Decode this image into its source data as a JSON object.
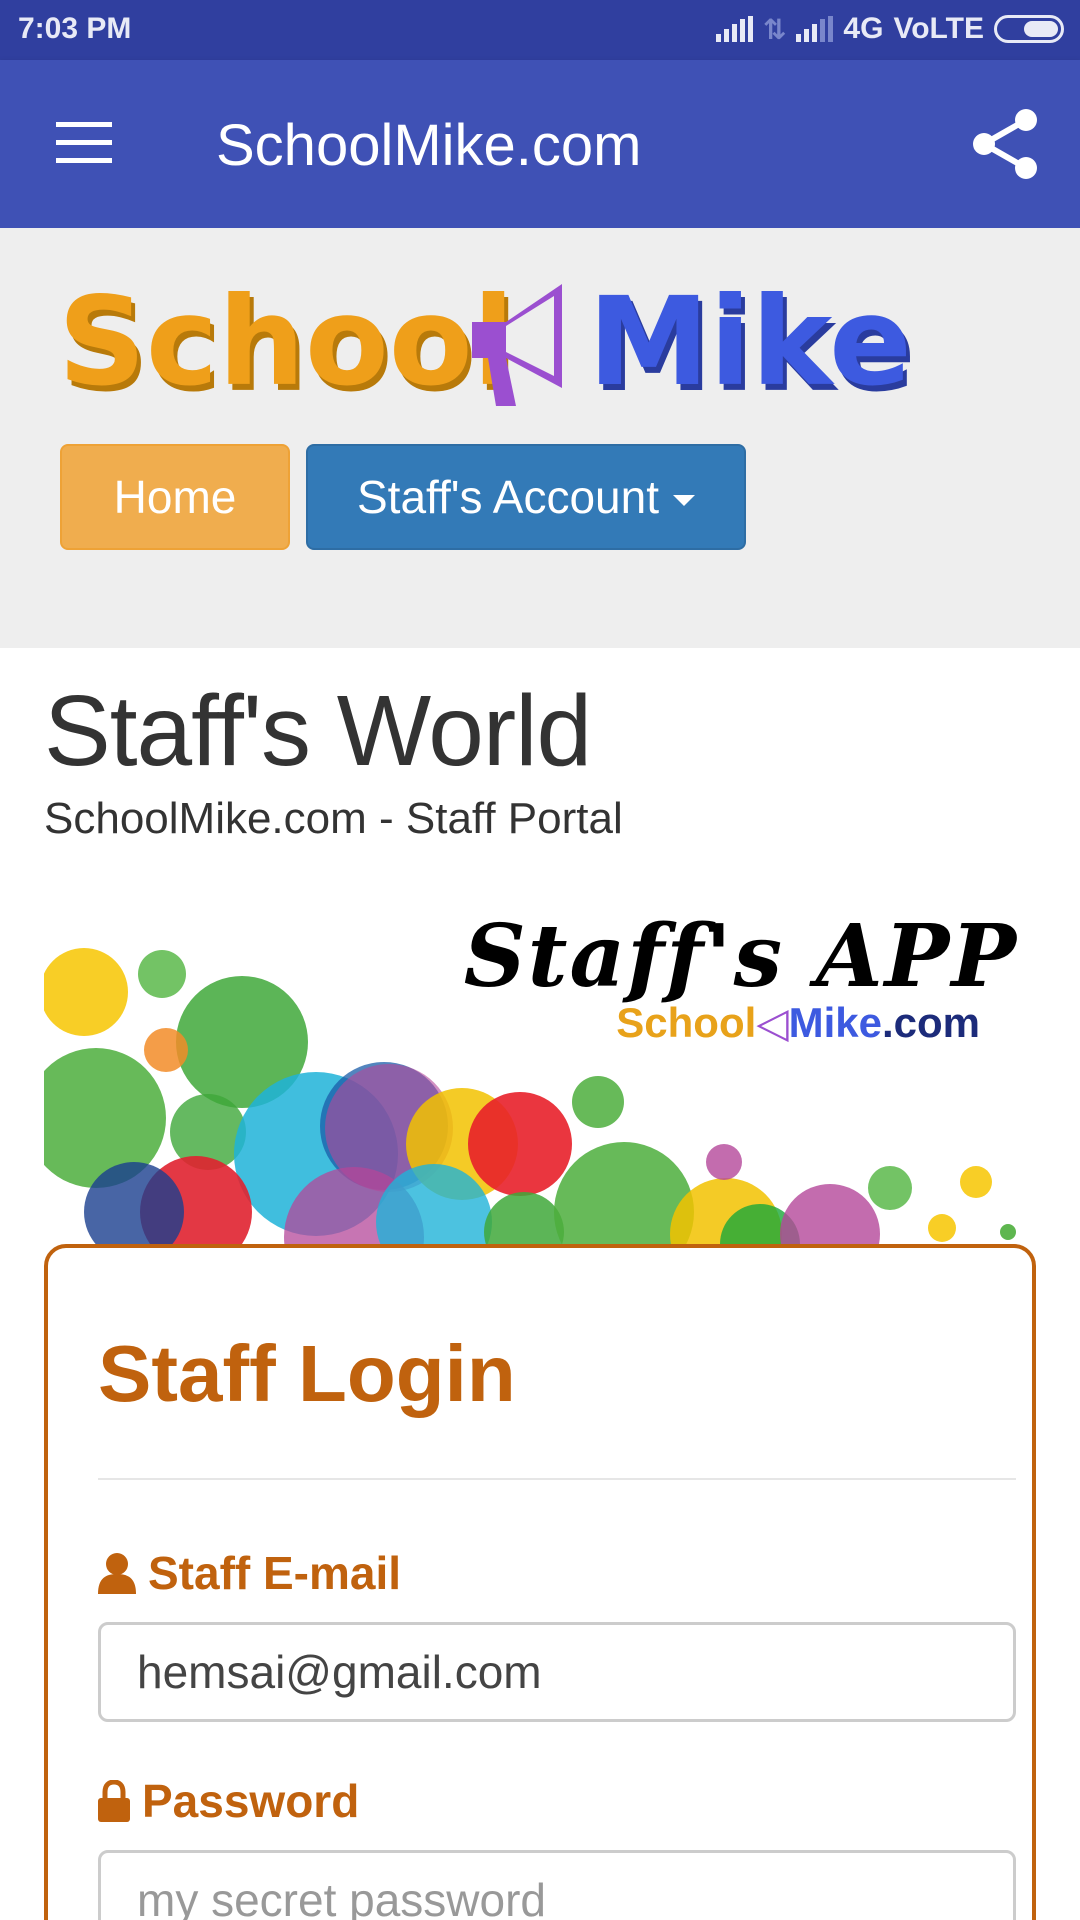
{
  "status_bar": {
    "time": "7:03 PM",
    "network": "4G",
    "volte": "VoLTE"
  },
  "app_bar": {
    "title": "SchoolMike.com"
  },
  "header": {
    "logo_text_left": "School",
    "logo_text_right": "Mike",
    "nav": {
      "home_label": "Home",
      "account_label": "Staff's Account"
    }
  },
  "main": {
    "title": "Staff's World",
    "subtitle": "SchoolMike.com - Staff Portal",
    "banner": {
      "title": "Staff's  APP",
      "brand_school": "School",
      "brand_mike": "Mike",
      "brand_domain": ".com"
    }
  },
  "login": {
    "title": "Staff Login",
    "email_label": "Staff E-mail",
    "email_value": "hemsai@gmail.com",
    "password_label": "Password",
    "password_placeholder": "my secret password"
  },
  "colors": {
    "status_bar": "#303f9f",
    "app_bar": "#3f51b5",
    "home_button": "#f0ad4e",
    "account_button": "#337ab7",
    "login_accent": "#c0620e"
  }
}
